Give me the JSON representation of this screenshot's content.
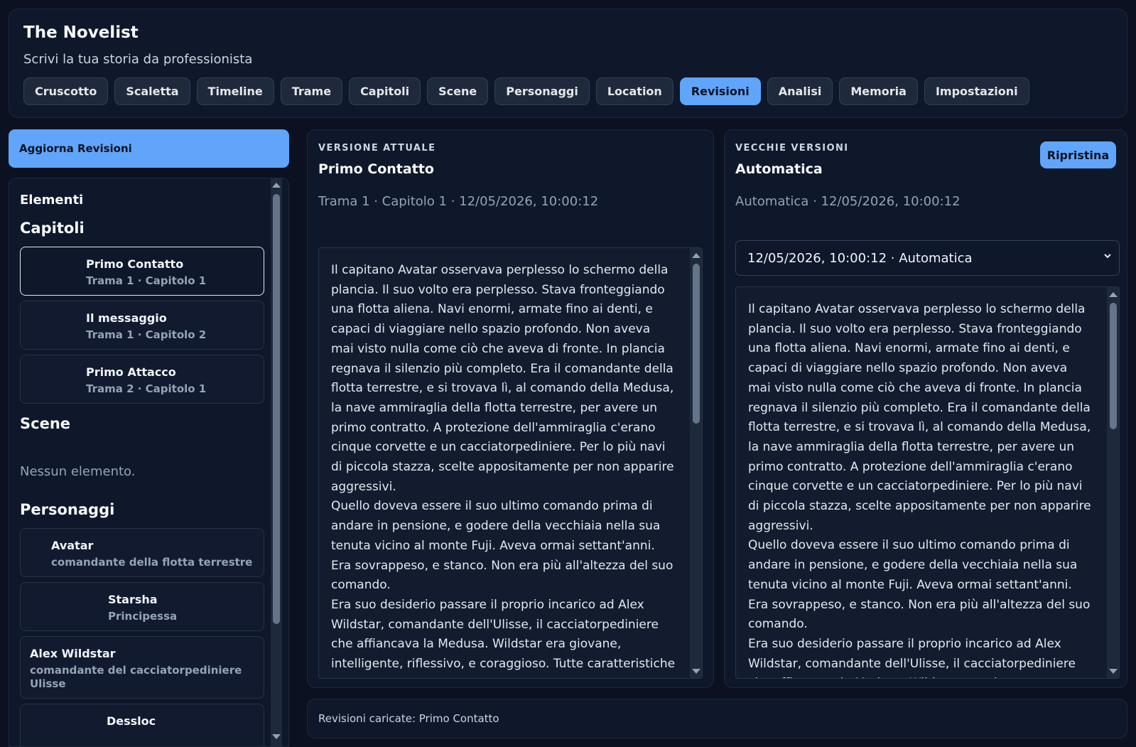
{
  "app": {
    "title": "The Novelist",
    "subtitle": "Scrivi la tua storia da professionista"
  },
  "nav": {
    "tabs": [
      "Cruscotto",
      "Scaletta",
      "Timeline",
      "Trame",
      "Capitoli",
      "Scene",
      "Personaggi",
      "Location",
      "Revisioni",
      "Analisi",
      "Memoria",
      "Impostazioni"
    ],
    "active": "Revisioni"
  },
  "sidebar": {
    "update_button": "Aggiorna Revisioni",
    "heading": "Elementi",
    "chapters_heading": "Capitoli",
    "chapters": [
      {
        "title": "Primo Contatto",
        "sub": "Trama 1 · Capitolo 1",
        "selected": true
      },
      {
        "title": "Il messaggio",
        "sub": "Trama 1 · Capitolo 2"
      },
      {
        "title": "Primo Attacco",
        "sub": "Trama 2 · Capitolo 1"
      }
    ],
    "scenes_heading": "Scene",
    "scenes_empty": "Nessun elemento.",
    "characters_heading": "Personaggi",
    "characters": [
      {
        "title": "Avatar",
        "sub": "comandante della flotta terrestre"
      },
      {
        "title": "Starsha",
        "sub": "Principessa"
      },
      {
        "title": "Alex Wildstar",
        "sub": "comandante del cacciatorpediniere Ulisse"
      },
      {
        "title": "Dessloc",
        "sub": ""
      }
    ]
  },
  "current": {
    "label": "VERSIONE ATTUALE",
    "title": "Primo Contatto",
    "meta": "Trama 1 · Capitolo 1 · 12/05/2026, 10:00:12",
    "text": "Il capitano Avatar osservava perplesso lo schermo della plancia. Il suo volto era perplesso. Stava fronteggiando una flotta aliena. Navi enormi, armate fino ai denti, e capaci di viaggiare nello spazio profondo. Non aveva mai visto nulla come ciò che aveva di fronte. In plancia regnava il silenzio più completo. Era il comandante della flotta terrestre, e si trovava lì, al comando della Medusa, la nave ammiraglia della flotta terrestre, per avere un primo contratto. A protezione dell'ammiraglia c'erano cinque corvette e un cacciatorpediniere. Per lo più navi di piccola stazza, scelte appositamente per non apparire aggressivi.\nQuello doveva essere il suo ultimo comando prima di andare in pensione, e godere della vecchiaia nella sua tenuta vicino al monte Fuji. Aveva ormai settant'anni. Era sovrappeso, e stanco. Non era più all'altezza del suo comando.\nEra suo desiderio passare il proprio incarico ad Alex Wildstar, comandante dell'Ulisse, il cacciatorpediniere che affiancava la Medusa. Wildstar era giovane, intelligente, riflessivo, e coraggioso. Tutte caratteristiche che dovevano appartenere a colui che si sarebbe fatto carico del"
  },
  "old": {
    "label": "VECCHIE VERSIONI",
    "title": "Automatica",
    "meta": "Automatica · 12/05/2026, 10:00:12",
    "restore_button": "Ripristina",
    "selected_version": "12/05/2026, 10:00:12 · Automatica",
    "text": "Il capitano Avatar osservava perplesso lo schermo della plancia. Il suo volto era perplesso. Stava fronteggiando una flotta aliena. Navi enormi, armate fino ai denti, e capaci di viaggiare nello spazio profondo. Non aveva mai visto nulla come ciò che aveva di fronte. In plancia regnava il silenzio più completo. Era il comandante della flotta terrestre, e si trovava lì, al comando della Medusa, la nave ammiraglia della flotta terrestre, per avere un primo contratto. A protezione dell'ammiraglia c'erano cinque corvette e un cacciatorpediniere. Per lo più navi di piccola stazza, scelte appositamente per non apparire aggressivi.\nQuello doveva essere il suo ultimo comando prima di andare in pensione, e godere della vecchiaia nella sua tenuta vicino al monte Fuji. Aveva ormai settant'anni. Era sovrappeso, e stanco. Non era più all'altezza del suo comando.\nEra suo desiderio passare il proprio incarico ad Alex Wildstar, comandante dell'Ulisse, il cacciatorpediniere che affiancava la Medusa. Wildstar era giovane, intelligente,"
  },
  "status": "Revisioni caricate: Primo Contatto",
  "colors": {
    "background": "#0b1120",
    "panel": "#0f172a",
    "accent": "#60a5fa"
  }
}
